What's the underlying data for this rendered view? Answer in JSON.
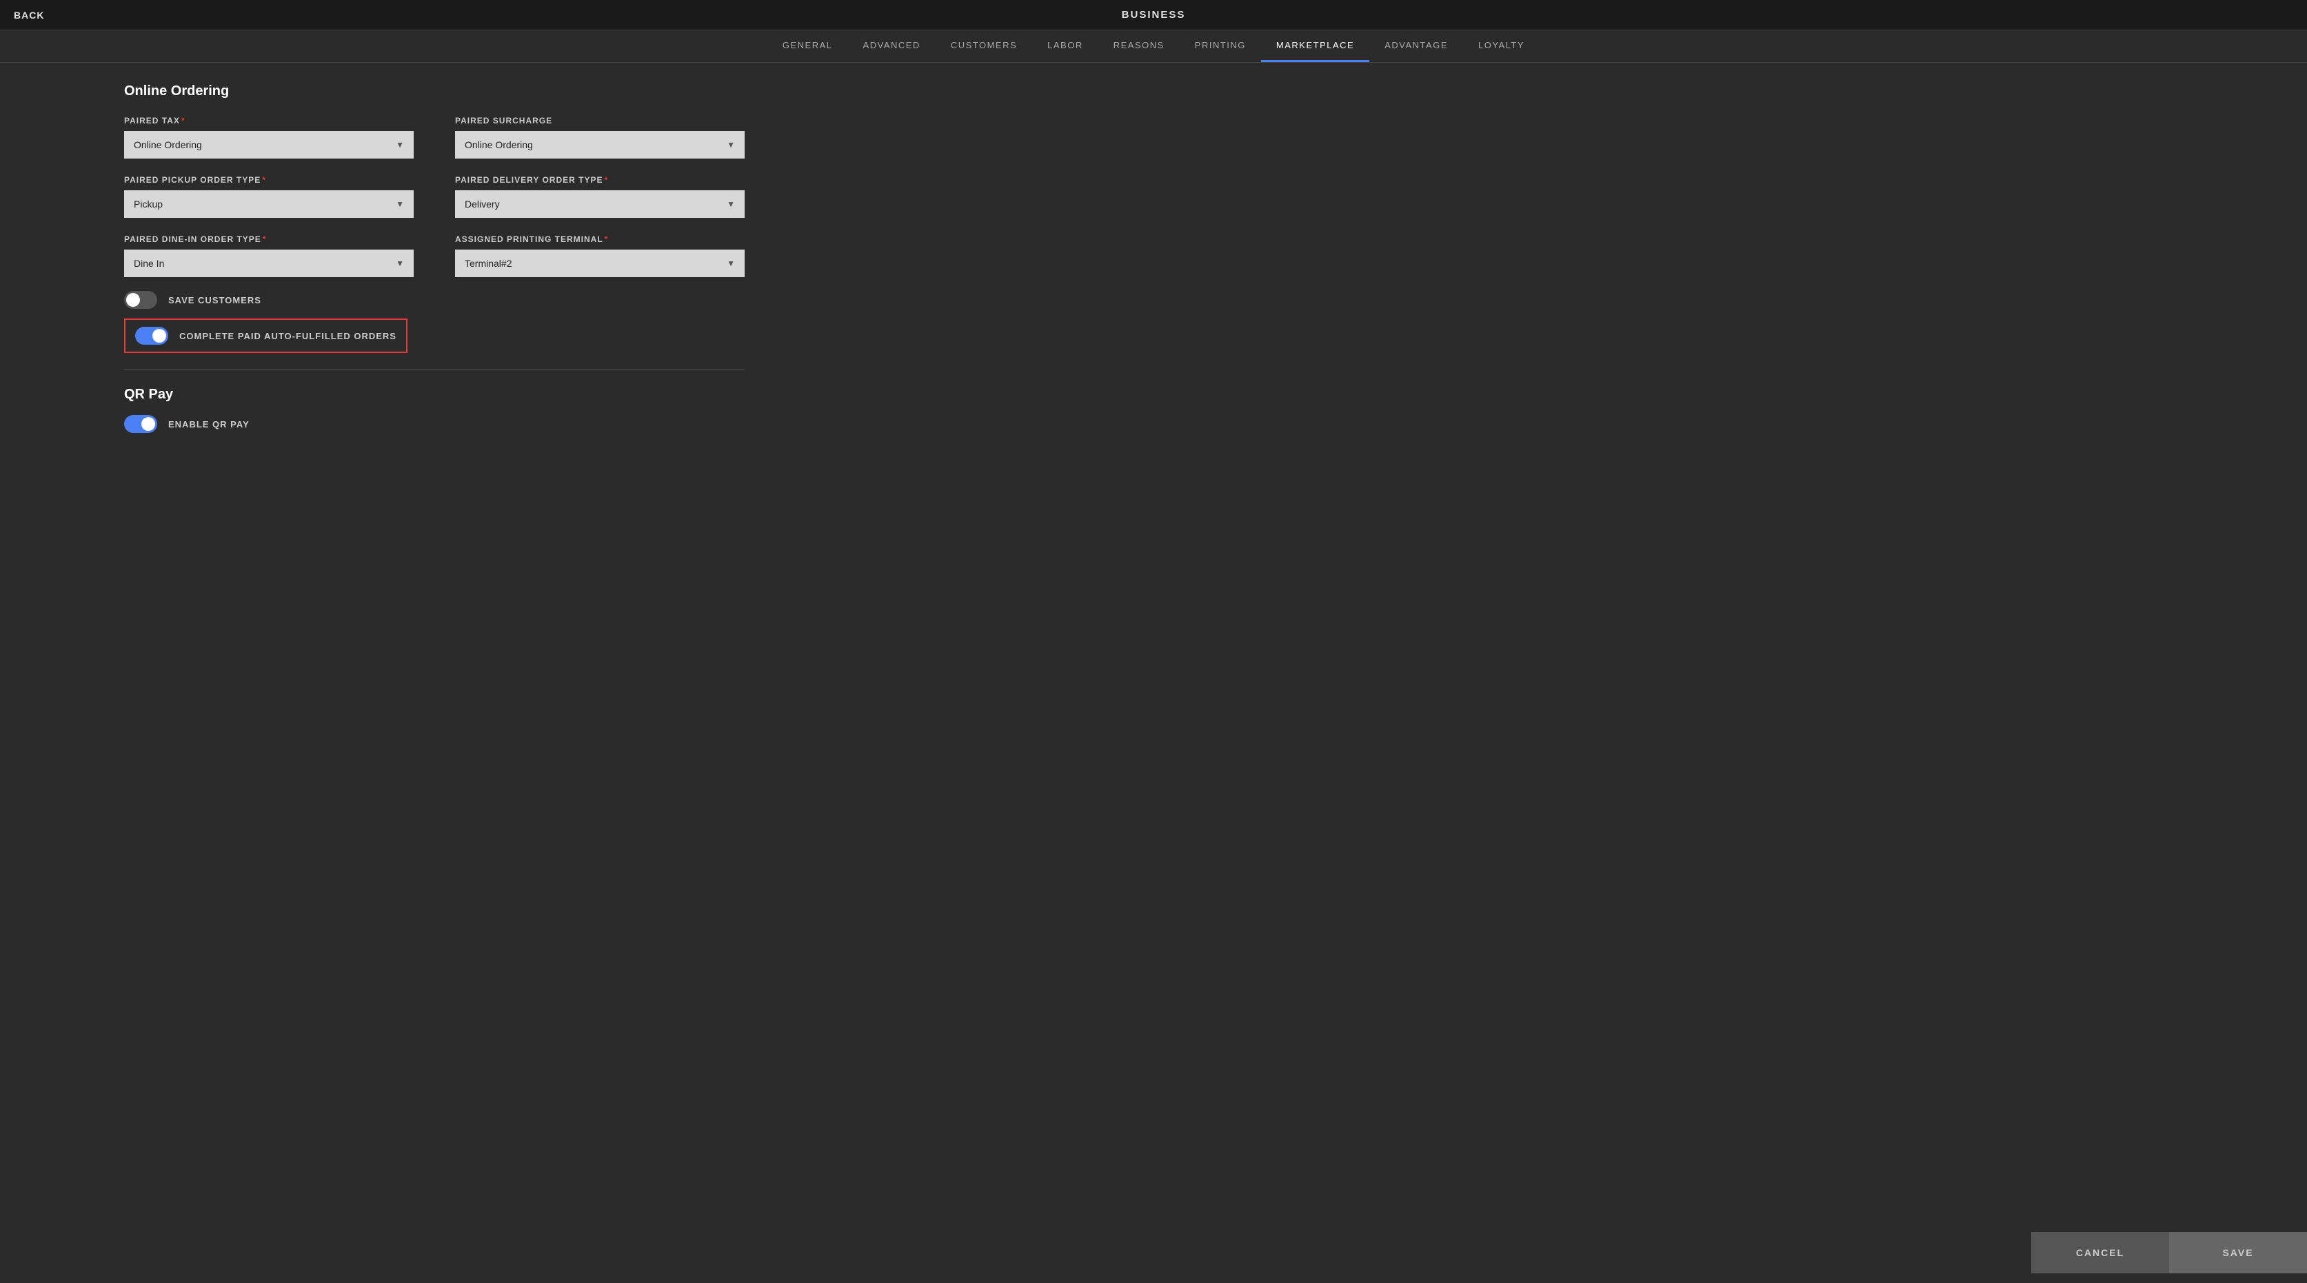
{
  "topBar": {
    "backLabel": "BACK",
    "title": "BUSINESS"
  },
  "navTabs": [
    {
      "id": "general",
      "label": "GENERAL",
      "active": false
    },
    {
      "id": "advanced",
      "label": "ADVANCED",
      "active": false
    },
    {
      "id": "customers",
      "label": "CUSTOMERS",
      "active": false
    },
    {
      "id": "labor",
      "label": "LABOR",
      "active": false
    },
    {
      "id": "reasons",
      "label": "REASONS",
      "active": false
    },
    {
      "id": "printing",
      "label": "PRINTING",
      "active": false
    },
    {
      "id": "marketplace",
      "label": "MARKETPLACE",
      "active": true
    },
    {
      "id": "advantage",
      "label": "ADVANTAGE",
      "active": false
    },
    {
      "id": "loyalty",
      "label": "LOYALTY",
      "active": false
    }
  ],
  "onlineOrdering": {
    "sectionTitle": "Online Ordering",
    "pairedTaxLabel": "PAIRED TAX",
    "pairedTaxValue": "Online Ordering",
    "pairedTaxOptions": [
      "Online Ordering"
    ],
    "pairedSurchargeLabel": "PAIRED SURCHARGE",
    "pairedSurchargeValue": "Online Ordering",
    "pairedSurchargeOptions": [
      "Online Ordering"
    ],
    "pairedPickupLabel": "PAIRED PICKUP ORDER TYPE",
    "pairedPickupValue": "Pickup",
    "pairedPickupOptions": [
      "Pickup"
    ],
    "pairedDeliveryLabel": "PAIRED DELIVERY ORDER TYPE",
    "pairedDeliveryValue": "Delivery",
    "pairedDeliveryOptions": [
      "Delivery"
    ],
    "pairedDineInLabel": "PAIRED DINE-IN ORDER TYPE",
    "pairedDineInValue": "Dine In",
    "pairedDineInOptions": [
      "Dine In"
    ],
    "assignedTerminalLabel": "ASSIGNED PRINTING TERMINAL",
    "assignedTerminalValue": "Terminal#2",
    "assignedTerminalOptions": [
      "Terminal#2"
    ],
    "saveCustomersLabel": "SAVE CUSTOMERS",
    "saveCustomersOn": false,
    "completePaidLabel": "COMPLETE PAID AUTO-FULFILLED ORDERS",
    "completePaidOn": true
  },
  "qrPay": {
    "sectionTitle": "QR Pay",
    "enableLabel": "ENABLE QR PAY",
    "enableOn": true
  },
  "footer": {
    "cancelLabel": "CANCEL",
    "saveLabel": "SAVE"
  }
}
